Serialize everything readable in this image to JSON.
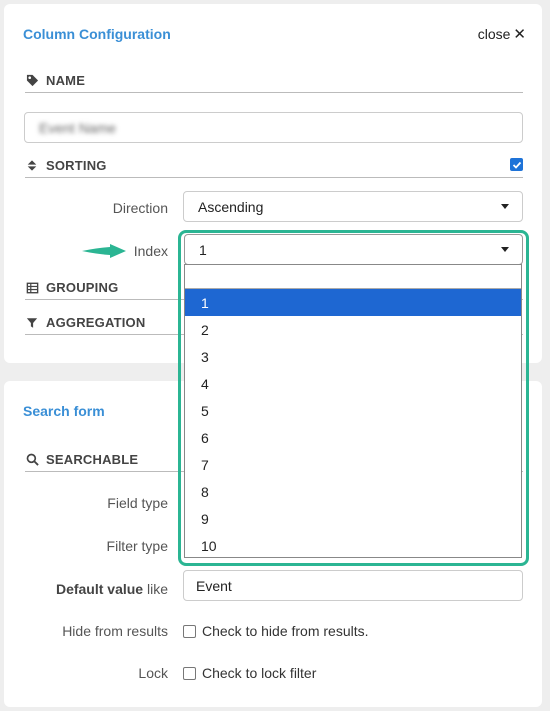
{
  "column_config": {
    "title": "Column Configuration",
    "close_label": "close",
    "close_glyph": "✕",
    "name_section": "NAME",
    "name_value": "Event Name",
    "sorting_section": "SORTING",
    "sorting_enabled": true,
    "direction_label": "Direction",
    "direction_value": "Ascending",
    "index_label": "Index",
    "index_value": "1",
    "grouping_section": "GROUPING",
    "aggregation_section": "AGGREGATION"
  },
  "index_dropdown": {
    "options": [
      "1",
      "2",
      "3",
      "4",
      "5",
      "6",
      "7",
      "8",
      "9",
      "10"
    ],
    "selected": "1"
  },
  "search_form": {
    "title": "Search form",
    "searchable_section": "SEARCHABLE",
    "field_type_label": "Field type",
    "filter_type_label": "Filter type",
    "default_value_label_bold": "Default value",
    "default_value_label_rest": " like",
    "default_value": "Event",
    "hide_label": "Hide from results",
    "hide_checkbox_text": "Check to hide from results.",
    "lock_label": "Lock",
    "lock_checkbox_text": "Check to lock filter"
  },
  "colors": {
    "accent_blue": "#3a8fd6",
    "selected_blue": "#1e67d2",
    "highlight_green": "#2bb593"
  },
  "icons": [
    "tag-icon",
    "sort-icon",
    "table-icon",
    "filter-icon",
    "search-icon",
    "close-icon",
    "caret-down-icon",
    "arrow-right-icon",
    "checkmark-icon"
  ]
}
